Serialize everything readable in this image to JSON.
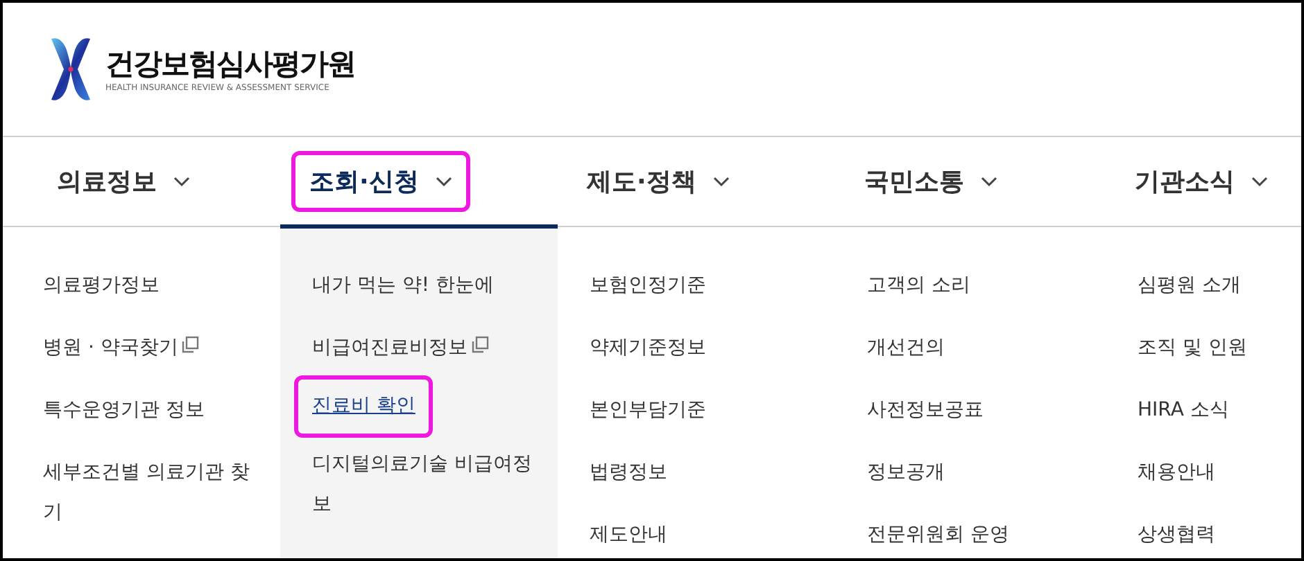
{
  "logo": {
    "name": "건강보험심사평가원",
    "subtitle": "HEALTH INSURANCE REVIEW & ASSESSMENT SERVICE"
  },
  "nav": [
    {
      "label": "의료정보",
      "selected": false,
      "highlighted": false,
      "items": [
        {
          "label": "의료평가정보",
          "external": false,
          "current": false,
          "highlighted": false
        },
        {
          "label": "병원 · 약국찾기",
          "external": true,
          "current": false,
          "highlighted": false
        },
        {
          "label": "특수운영기관 정보",
          "external": false,
          "current": false,
          "highlighted": false
        },
        {
          "label": "세부조건별 의료기관 찾기",
          "external": false,
          "current": false,
          "highlighted": false
        }
      ]
    },
    {
      "label": "조회·신청",
      "selected": true,
      "highlighted": true,
      "items": [
        {
          "label": "내가 먹는 약! 한눈에",
          "external": false,
          "current": false,
          "highlighted": false
        },
        {
          "label": "비급여진료비정보",
          "external": true,
          "current": false,
          "highlighted": false
        },
        {
          "label": "진료비 확인",
          "external": false,
          "current": true,
          "highlighted": true
        },
        {
          "label": "디지털의료기술 비급여정보",
          "external": false,
          "current": false,
          "highlighted": false
        }
      ]
    },
    {
      "label": "제도·정책",
      "selected": false,
      "highlighted": false,
      "items": [
        {
          "label": "보험인정기준",
          "external": false,
          "current": false,
          "highlighted": false
        },
        {
          "label": "약제기준정보",
          "external": false,
          "current": false,
          "highlighted": false
        },
        {
          "label": "본인부담기준",
          "external": false,
          "current": false,
          "highlighted": false
        },
        {
          "label": "법령정보",
          "external": false,
          "current": false,
          "highlighted": false
        },
        {
          "label": "제도안내",
          "external": false,
          "current": false,
          "highlighted": false
        }
      ]
    },
    {
      "label": "국민소통",
      "selected": false,
      "highlighted": false,
      "items": [
        {
          "label": "고객의 소리",
          "external": false,
          "current": false,
          "highlighted": false
        },
        {
          "label": "개선건의",
          "external": false,
          "current": false,
          "highlighted": false
        },
        {
          "label": "사전정보공표",
          "external": false,
          "current": false,
          "highlighted": false
        },
        {
          "label": "정보공개",
          "external": false,
          "current": false,
          "highlighted": false
        },
        {
          "label": "전문위원회 운영",
          "external": false,
          "current": false,
          "highlighted": false
        }
      ]
    },
    {
      "label": "기관소식",
      "selected": false,
      "highlighted": false,
      "items": [
        {
          "label": "심평원 소개",
          "external": false,
          "current": false,
          "highlighted": false
        },
        {
          "label": "조직 및 인원",
          "external": false,
          "current": false,
          "highlighted": false
        },
        {
          "label": "HIRA 소식",
          "external": false,
          "current": false,
          "highlighted": false
        },
        {
          "label": "채용안내",
          "external": false,
          "current": false,
          "highlighted": false
        },
        {
          "label": "상생협력",
          "external": false,
          "current": false,
          "highlighted": false
        }
      ]
    }
  ]
}
